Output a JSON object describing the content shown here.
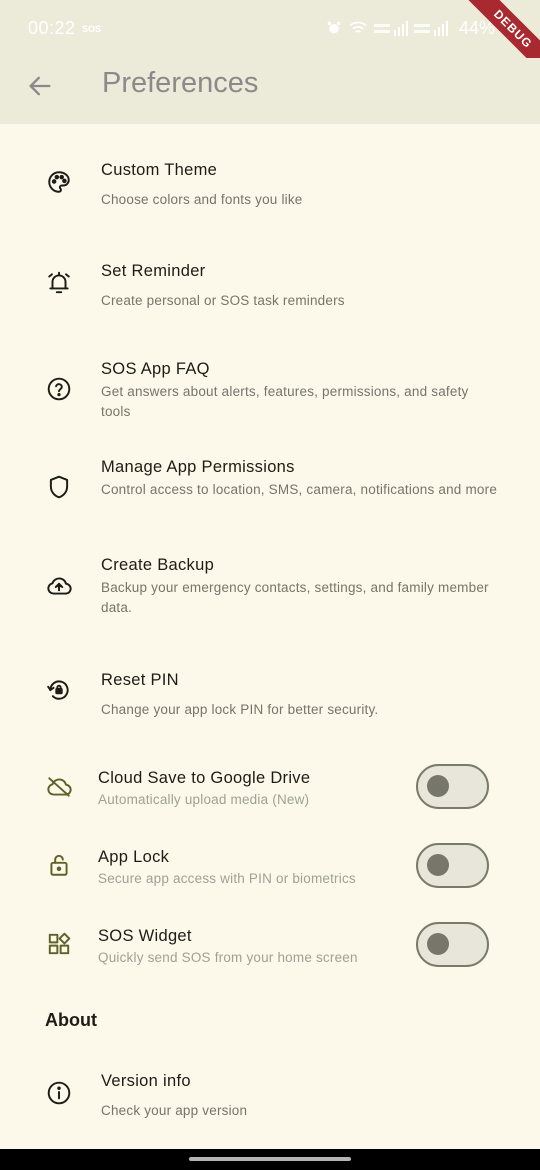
{
  "status": {
    "time": "00:22",
    "sos_label": "SOS",
    "battery": "44%",
    "debug_label": "DEBUG"
  },
  "appbar": {
    "title": "Preferences"
  },
  "items": [
    {
      "title": "Custom Theme",
      "subtitle": "Choose colors and fonts you like",
      "icon": "palette-icon"
    },
    {
      "title": "Set Reminder",
      "subtitle": "Create personal or SOS task reminders",
      "icon": "alarm-icon"
    },
    {
      "title": "SOS App FAQ",
      "subtitle": "Get answers about alerts, features, permissions, and safety tools",
      "icon": "help-icon"
    },
    {
      "title": "Manage App Permissions",
      "subtitle": "Control access to location, SMS, camera, notifications and more",
      "icon": "shield-icon"
    },
    {
      "title": "Create Backup",
      "subtitle": "Backup your emergency contacts, settings, and family member data.",
      "icon": "cloud-upload-icon"
    },
    {
      "title": "Reset PIN",
      "subtitle": "Change your app lock PIN for better security.",
      "icon": "lock-reset-icon"
    }
  ],
  "toggles": [
    {
      "title": "Cloud Save to Google Drive",
      "subtitle": "Automatically upload media (New)",
      "icon": "cloud-off-icon",
      "on": false
    },
    {
      "title": "App Lock",
      "subtitle": "Secure app access with PIN or biometrics",
      "icon": "lock-open-icon",
      "on": false
    },
    {
      "title": "SOS Widget",
      "subtitle": "Quickly send SOS from your home screen",
      "icon": "widgets-icon",
      "on": false
    }
  ],
  "about": {
    "heading": "About",
    "version_title": "Version info",
    "version_subtitle": "Check your app version"
  },
  "colors": {
    "background": "#fcf9ea",
    "appbar": "#ecead9",
    "accent_icon": "#5f6127",
    "debug_banner": "#a8292f"
  }
}
